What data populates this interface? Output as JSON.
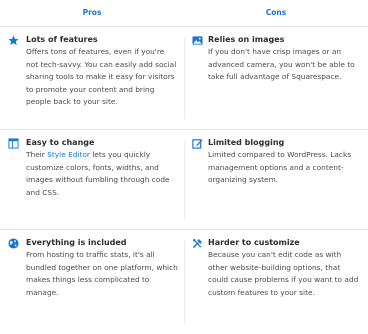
{
  "headers": {
    "pros": "Pros",
    "cons": "Cons"
  },
  "rows": [
    {
      "pro": {
        "icon": "star-icon",
        "title": "Lots of features",
        "desc": "Offers tons of features, even if you're not tech-savvy. You can easily add social sharing tools to make it easy for visitors to promote your content and bring people back to your site."
      },
      "con": {
        "icon": "image-icon",
        "title": "Relies on images",
        "desc": "If you don't have crisp images or an advanced camera, you won't be able to take full advantage of Squarespace."
      }
    },
    {
      "pro": {
        "icon": "layout-icon",
        "title": "Easy to change",
        "desc_before": "Their ",
        "link": "Style Editor",
        "desc_after": " lets you quickly customize colors, fonts, widths, and images without fumbling through code and CSS."
      },
      "con": {
        "icon": "edit-icon",
        "title": "Limited blogging",
        "desc": "Limited compared to WordPress. Lacks management options and a content-organizing system."
      }
    },
    {
      "pro": {
        "icon": "globe-icon",
        "title": "Everything is included",
        "desc": "From hosting to traffic stats, it's all bundled together on one platform, which makes things less complicated to manage."
      },
      "con": {
        "icon": "tools-icon",
        "title": "Harder to customize",
        "desc": "Because you can't edit code as with other website-building options, that could cause problems if you want to add custom features to your site."
      }
    }
  ],
  "colors": {
    "accent": "#1976d2",
    "text": "#4a4a4a",
    "divider": "#e6e6e6"
  }
}
